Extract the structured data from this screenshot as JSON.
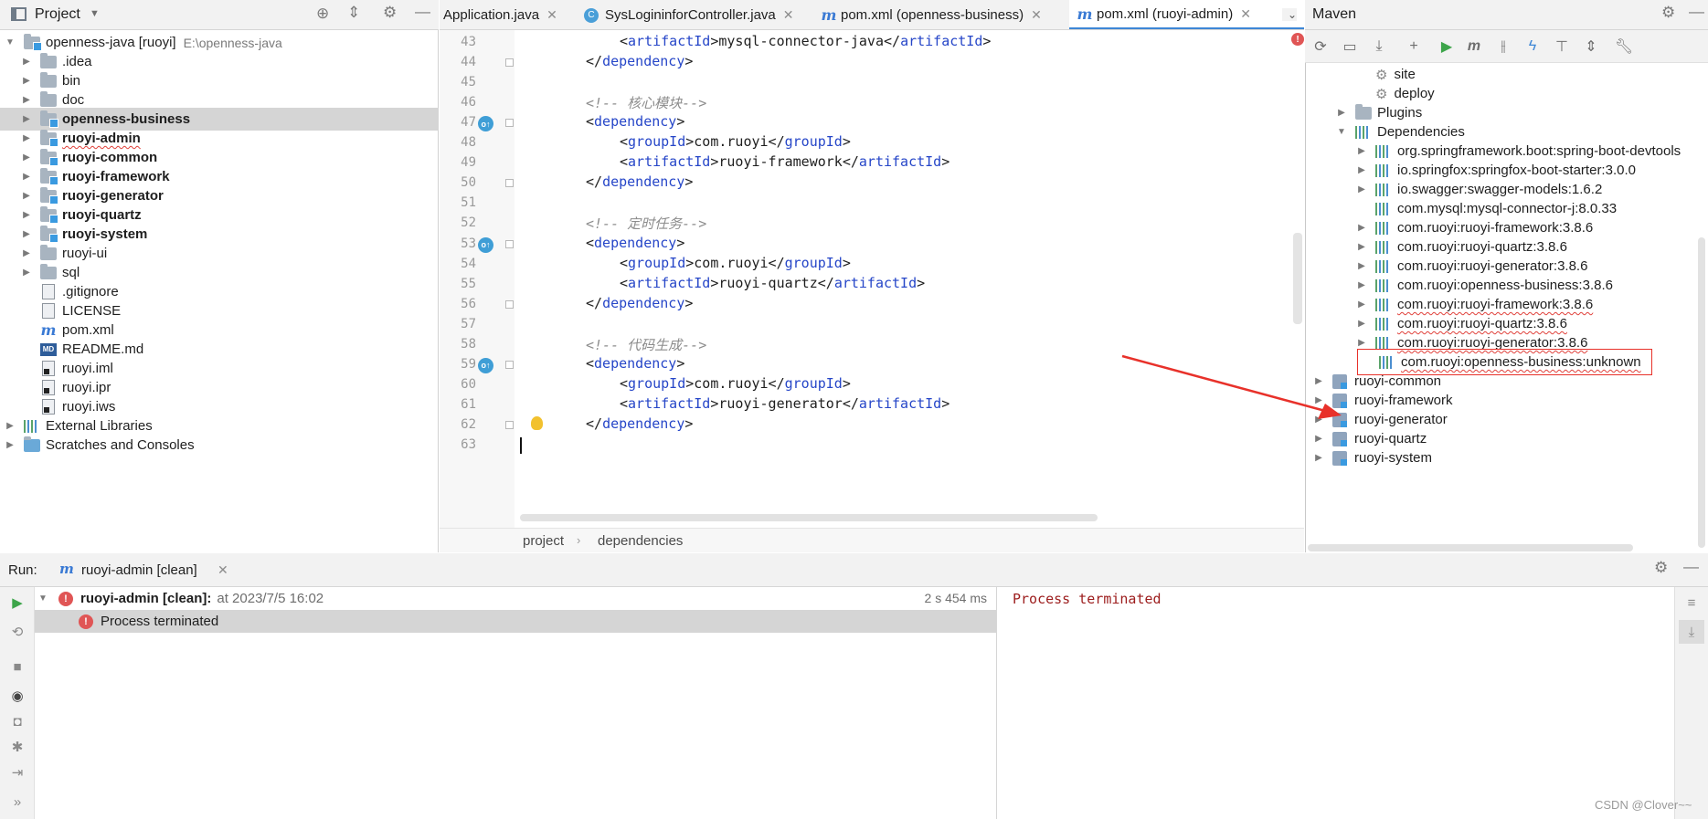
{
  "project": {
    "title": "Project",
    "tree": [
      {
        "label": "openness-java [ruoyi]",
        "sub": "E:\\openness-java",
        "kind": "root",
        "indent": 0,
        "expanded": true
      },
      {
        "label": ".idea",
        "kind": "folder",
        "indent": 1
      },
      {
        "label": "bin",
        "kind": "folder",
        "indent": 1
      },
      {
        "label": "doc",
        "kind": "folder",
        "indent": 1
      },
      {
        "label": "openness-business",
        "kind": "module",
        "indent": 1,
        "selected": true
      },
      {
        "label": "ruoyi-admin",
        "kind": "module",
        "indent": 1,
        "squiggle": true
      },
      {
        "label": "ruoyi-common",
        "kind": "module",
        "indent": 1
      },
      {
        "label": "ruoyi-framework",
        "kind": "module",
        "indent": 1
      },
      {
        "label": "ruoyi-generator",
        "kind": "module",
        "indent": 1
      },
      {
        "label": "ruoyi-quartz",
        "kind": "module",
        "indent": 1
      },
      {
        "label": "ruoyi-system",
        "kind": "module",
        "indent": 1
      },
      {
        "label": "ruoyi-ui",
        "kind": "folder",
        "indent": 1
      },
      {
        "label": "sql",
        "kind": "folder",
        "indent": 1
      },
      {
        "label": ".gitignore",
        "kind": "file",
        "indent": 1
      },
      {
        "label": "LICENSE",
        "kind": "file",
        "indent": 1
      },
      {
        "label": "pom.xml",
        "kind": "maven",
        "indent": 1
      },
      {
        "label": "README.md",
        "kind": "md",
        "indent": 1
      },
      {
        "label": "ruoyi.iml",
        "kind": "darkfile",
        "indent": 1
      },
      {
        "label": "ruoyi.ipr",
        "kind": "darkfile",
        "indent": 1
      },
      {
        "label": "ruoyi.iws",
        "kind": "darkfile",
        "indent": 1
      },
      {
        "label": "External Libraries",
        "kind": "libs",
        "indent": 0
      },
      {
        "label": "Scratches and Consoles",
        "kind": "scratch",
        "indent": 0
      }
    ]
  },
  "editor": {
    "tabs": [
      {
        "label": "Application.java",
        "icon": "none",
        "active": false
      },
      {
        "label": "SysLogininforController.java",
        "icon": "class",
        "active": false
      },
      {
        "label": "pom.xml (openness-business)",
        "icon": "maven",
        "active": false
      },
      {
        "label": "pom.xml (ruoyi-admin)",
        "icon": "maven",
        "active": true
      }
    ],
    "lines": [
      {
        "n": "43",
        "indent": 2,
        "parts": [
          {
            "t": "<",
            "c": "p"
          },
          {
            "t": "artifactId",
            "c": "tag"
          },
          {
            "t": ">mysql-connector-java</",
            "c": "p"
          },
          {
            "t": "artifactId",
            "c": "tag"
          },
          {
            "t": ">",
            "c": "p"
          }
        ]
      },
      {
        "n": "44",
        "indent": 1,
        "parts": [
          {
            "t": "</",
            "c": "p"
          },
          {
            "t": "dependency",
            "c": "tag"
          },
          {
            "t": ">",
            "c": "p"
          }
        ]
      },
      {
        "n": "45",
        "indent": 0,
        "parts": []
      },
      {
        "n": "46",
        "indent": 1,
        "parts": [
          {
            "t": "<!-- 核心模块-->",
            "c": "cm"
          }
        ]
      },
      {
        "n": "47",
        "indent": 1,
        "parts": [
          {
            "t": "<",
            "c": "p"
          },
          {
            "t": "dependency",
            "c": "tag"
          },
          {
            "t": ">",
            "c": "p"
          }
        ],
        "gutter": true
      },
      {
        "n": "48",
        "indent": 2,
        "parts": [
          {
            "t": "<",
            "c": "p"
          },
          {
            "t": "groupId",
            "c": "tag"
          },
          {
            "t": ">com.ruoyi</",
            "c": "p"
          },
          {
            "t": "groupId",
            "c": "tag"
          },
          {
            "t": ">",
            "c": "p"
          }
        ]
      },
      {
        "n": "49",
        "indent": 2,
        "parts": [
          {
            "t": "<",
            "c": "p"
          },
          {
            "t": "artifactId",
            "c": "tag"
          },
          {
            "t": ">ruoyi-framework</",
            "c": "p"
          },
          {
            "t": "artifactId",
            "c": "tag"
          },
          {
            "t": ">",
            "c": "p"
          }
        ]
      },
      {
        "n": "50",
        "indent": 1,
        "parts": [
          {
            "t": "</",
            "c": "p"
          },
          {
            "t": "dependency",
            "c": "tag"
          },
          {
            "t": ">",
            "c": "p"
          }
        ]
      },
      {
        "n": "51",
        "indent": 0,
        "parts": []
      },
      {
        "n": "52",
        "indent": 1,
        "parts": [
          {
            "t": "<!-- 定时任务-->",
            "c": "cm"
          }
        ]
      },
      {
        "n": "53",
        "indent": 1,
        "parts": [
          {
            "t": "<",
            "c": "p"
          },
          {
            "t": "dependency",
            "c": "tag"
          },
          {
            "t": ">",
            "c": "p"
          }
        ],
        "gutter": true
      },
      {
        "n": "54",
        "indent": 2,
        "parts": [
          {
            "t": "<",
            "c": "p"
          },
          {
            "t": "groupId",
            "c": "tag"
          },
          {
            "t": ">com.ruoyi</",
            "c": "p"
          },
          {
            "t": "groupId",
            "c": "tag"
          },
          {
            "t": ">",
            "c": "p"
          }
        ]
      },
      {
        "n": "55",
        "indent": 2,
        "parts": [
          {
            "t": "<",
            "c": "p"
          },
          {
            "t": "artifactId",
            "c": "tag"
          },
          {
            "t": ">ruoyi-quartz</",
            "c": "p"
          },
          {
            "t": "artifactId",
            "c": "tag"
          },
          {
            "t": ">",
            "c": "p"
          }
        ]
      },
      {
        "n": "56",
        "indent": 1,
        "parts": [
          {
            "t": "</",
            "c": "p"
          },
          {
            "t": "dependency",
            "c": "tag"
          },
          {
            "t": ">",
            "c": "p"
          }
        ]
      },
      {
        "n": "57",
        "indent": 0,
        "parts": []
      },
      {
        "n": "58",
        "indent": 1,
        "parts": [
          {
            "t": "<!-- 代码生成-->",
            "c": "cm"
          }
        ]
      },
      {
        "n": "59",
        "indent": 1,
        "parts": [
          {
            "t": "<",
            "c": "p"
          },
          {
            "t": "dependency",
            "c": "tag"
          },
          {
            "t": ">",
            "c": "p"
          }
        ],
        "gutter": true
      },
      {
        "n": "60",
        "indent": 2,
        "parts": [
          {
            "t": "<",
            "c": "p"
          },
          {
            "t": "groupId",
            "c": "tag"
          },
          {
            "t": ">com.ruoyi</",
            "c": "p"
          },
          {
            "t": "groupId",
            "c": "tag"
          },
          {
            "t": ">",
            "c": "p"
          }
        ]
      },
      {
        "n": "61",
        "indent": 2,
        "parts": [
          {
            "t": "<",
            "c": "p"
          },
          {
            "t": "artifactId",
            "c": "tag"
          },
          {
            "t": ">ruoyi-generator</",
            "c": "p"
          },
          {
            "t": "artifactId",
            "c": "tag"
          },
          {
            "t": ">",
            "c": "p"
          }
        ]
      },
      {
        "n": "62",
        "indent": 1,
        "parts": [
          {
            "t": "</",
            "c": "p"
          },
          {
            "t": "dependency",
            "c": "tag"
          },
          {
            "t": ">",
            "c": "p"
          }
        ],
        "bulb": true
      },
      {
        "n": "63",
        "indent": 0,
        "parts": []
      }
    ],
    "breadcrumb": [
      "project",
      "dependencies"
    ]
  },
  "maven": {
    "title": "Maven",
    "rows": [
      {
        "label": "site",
        "kind": "goal",
        "indent": 3,
        "chev": false
      },
      {
        "label": "deploy",
        "kind": "goal",
        "indent": 3,
        "chev": false
      },
      {
        "label": "Plugins",
        "kind": "plugins",
        "indent": 2,
        "chev": "right"
      },
      {
        "label": "Dependencies",
        "kind": "deps",
        "indent": 2,
        "chev": "down"
      },
      {
        "label": "org.springframework.boot:spring-boot-devtools",
        "kind": "lib",
        "indent": 3,
        "chev": "right"
      },
      {
        "label": "io.springfox:springfox-boot-starter:3.0.0",
        "kind": "lib",
        "indent": 3,
        "chev": "right"
      },
      {
        "label": "io.swagger:swagger-models:1.6.2",
        "kind": "lib",
        "indent": 3,
        "chev": "right"
      },
      {
        "label": "com.mysql:mysql-connector-j:8.0.33",
        "kind": "lib",
        "indent": 3,
        "chev": false
      },
      {
        "label": "com.ruoyi:ruoyi-framework:3.8.6",
        "kind": "lib",
        "indent": 3,
        "chev": "right"
      },
      {
        "label": "com.ruoyi:ruoyi-quartz:3.8.6",
        "kind": "lib",
        "indent": 3,
        "chev": "right"
      },
      {
        "label": "com.ruoyi:ruoyi-generator:3.8.6",
        "kind": "lib",
        "indent": 3,
        "chev": "right"
      },
      {
        "label": "com.ruoyi:openness-business:3.8.6",
        "kind": "lib",
        "indent": 3,
        "chev": "right"
      },
      {
        "label": "com.ruoyi:ruoyi-framework:3.8.6",
        "kind": "lib",
        "indent": 3,
        "chev": "right",
        "squiggle": true
      },
      {
        "label": "com.ruoyi:ruoyi-quartz:3.8.6",
        "kind": "lib",
        "indent": 3,
        "chev": "right",
        "squiggle": true
      },
      {
        "label": "com.ruoyi:ruoyi-generator:3.8.6",
        "kind": "lib",
        "indent": 3,
        "chev": "right",
        "squiggle": true
      },
      {
        "label": "com.ruoyi:openness-business:unknown",
        "kind": "lib",
        "indent": 3,
        "chev": false,
        "squiggle": true,
        "highlight": true
      },
      {
        "label": "ruoyi-common",
        "kind": "module",
        "indent": 1,
        "chev": "right"
      },
      {
        "label": "ruoyi-framework",
        "kind": "module",
        "indent": 1,
        "chev": "right"
      },
      {
        "label": "ruoyi-generator",
        "kind": "module",
        "indent": 1,
        "chev": "right"
      },
      {
        "label": "ruoyi-quartz",
        "kind": "module",
        "indent": 1,
        "chev": "right"
      },
      {
        "label": "ruoyi-system",
        "kind": "module",
        "indent": 1,
        "chev": "right"
      }
    ]
  },
  "run": {
    "label": "Run:",
    "tab": "ruoyi-admin [clean]",
    "tree": [
      {
        "title": "ruoyi-admin [clean]:",
        "detail": "at 2023/7/5 16:02",
        "time": "2 s 454 ms"
      },
      {
        "title": "Process terminated",
        "detail": "",
        "time": ""
      }
    ],
    "console": "Process terminated"
  },
  "watermark": "CSDN @Clover~~",
  "colors": {
    "accent": "#3d86d6",
    "error": "#e05555",
    "arrow": "#e8312a",
    "console_text": "#9c1c1c"
  }
}
